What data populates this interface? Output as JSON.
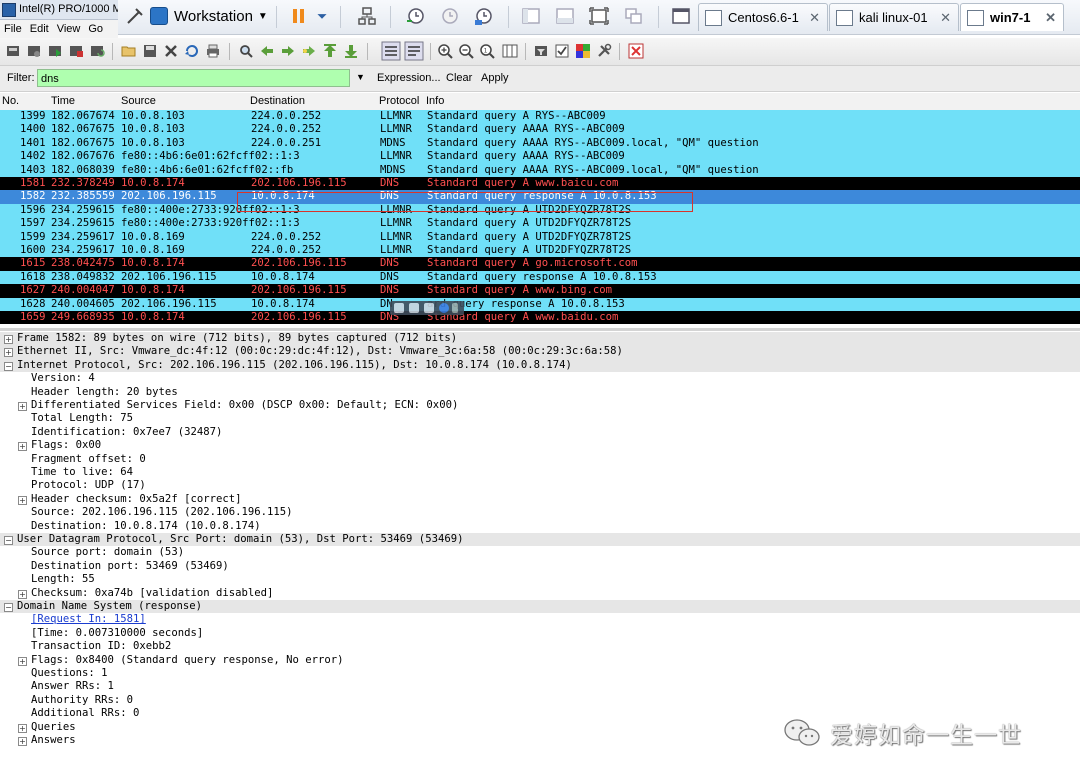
{
  "window": {
    "title": "Intel(R) PRO/1000 M",
    "menu": [
      "File",
      "Edit",
      "View",
      "Go"
    ]
  },
  "vmware": {
    "workspace_label": "Workstation",
    "tabs": [
      {
        "label": "Centos6.6-1",
        "active": false
      },
      {
        "label": "kali linux-01",
        "active": false
      },
      {
        "label": "win7-1",
        "active": true
      }
    ]
  },
  "filter": {
    "label": "Filter:",
    "value": "dns",
    "expression_label": "Expression...",
    "clear_label": "Clear",
    "apply_label": "Apply"
  },
  "packet_list": {
    "columns": [
      "No.",
      "Time",
      "Source",
      "Destination",
      "Protocol",
      "Info"
    ],
    "rows": [
      {
        "no": "1399",
        "time": "182.067674",
        "src": "10.0.8.103",
        "dst": "224.0.0.252",
        "proto": "LLMNR",
        "info": "Standard query A RYS--ABC009",
        "style": "c-llmnr"
      },
      {
        "no": "1400",
        "time": "182.067675",
        "src": "10.0.8.103",
        "dst": "224.0.0.252",
        "proto": "LLMNR",
        "info": "Standard query AAAA RYS--ABC009",
        "style": "c-llmnr"
      },
      {
        "no": "1401",
        "time": "182.067675",
        "src": "10.0.8.103",
        "dst": "224.0.0.251",
        "proto": "MDNS",
        "info": "Standard query AAAA RYS--ABC009.local, \"QM\" question",
        "style": "c-mdns"
      },
      {
        "no": "1402",
        "time": "182.067676",
        "src": "fe80::4b6:6e01:62fcff02::1:3",
        "dst": "",
        "proto": "LLMNR",
        "info": "Standard query AAAA RYS--ABC009",
        "style": "c-llmnr"
      },
      {
        "no": "1403",
        "time": "182.068039",
        "src": "fe80::4b6:6e01:62fcff02::fb",
        "dst": "",
        "proto": "MDNS",
        "info": "Standard query AAAA RYS--ABC009.local, \"QM\" question",
        "style": "c-mdns"
      },
      {
        "no": "1581",
        "time": "232.378249",
        "src": "10.0.8.174",
        "dst": "202.106.196.115",
        "proto": "DNS",
        "info": "Standard query A www.baicu.com",
        "style": "c-bad"
      },
      {
        "no": "1582",
        "time": "232.385559",
        "src": "202.106.196.115",
        "dst": "10.0.8.174",
        "proto": "DNS",
        "info": "Standard query response A 10.0.8.153",
        "style": "c-sel"
      },
      {
        "no": "1596",
        "time": "234.259615",
        "src": "fe80::400e:2733:920ff02::1:3",
        "dst": "",
        "proto": "LLMNR",
        "info": "Standard query A UTD2DFYQZR78T2S",
        "style": "c-llmnr"
      },
      {
        "no": "1597",
        "time": "234.259615",
        "src": "fe80::400e:2733:920ff02::1:3",
        "dst": "",
        "proto": "LLMNR",
        "info": "Standard query A UTD2DFYQZR78T2S",
        "style": "c-llmnr"
      },
      {
        "no": "1599",
        "time": "234.259617",
        "src": "10.0.8.169",
        "dst": "224.0.0.252",
        "proto": "LLMNR",
        "info": "Standard query A UTD2DFYQZR78T2S",
        "style": "c-llmnr"
      },
      {
        "no": "1600",
        "time": "234.259617",
        "src": "10.0.8.169",
        "dst": "224.0.0.252",
        "proto": "LLMNR",
        "info": "Standard query A UTD2DFYQZR78T2S",
        "style": "c-llmnr"
      },
      {
        "no": "1615",
        "time": "238.042475",
        "src": "10.0.8.174",
        "dst": "202.106.196.115",
        "proto": "DNS",
        "info": "Standard query A go.microsoft.com",
        "style": "c-bad"
      },
      {
        "no": "1618",
        "time": "238.049832",
        "src": "202.106.196.115",
        "dst": "10.0.8.174",
        "proto": "DNS",
        "info": "Standard query response A 10.0.8.153",
        "style": "c-resp"
      },
      {
        "no": "1627",
        "time": "240.004047",
        "src": "10.0.8.174",
        "dst": "202.106.196.115",
        "proto": "DNS",
        "info": "Standard query A www.bing.com",
        "style": "c-bad"
      },
      {
        "no": "1628",
        "time": "240.004605",
        "src": "202.106.196.115",
        "dst": "10.0.8.174",
        "proto": "DN",
        "info": "ard query response A 10.0.8.153",
        "style": "c-resp"
      },
      {
        "no": "1659",
        "time": "249.668935",
        "src": "10.0.8.174",
        "dst": "202.106.196.115",
        "proto": "DNS",
        "info": "Standard query A www.baidu.com",
        "style": "c-bad"
      }
    ]
  },
  "details": [
    {
      "level": 0,
      "toggle": "+",
      "text": "Frame 1582: 89 bytes on wire (712 bits), 89 bytes captured (712 bits)",
      "top": true
    },
    {
      "level": 0,
      "toggle": "+",
      "text": "Ethernet II, Src: Vmware_dc:4f:12 (00:0c:29:dc:4f:12), Dst: Vmware_3c:6a:58 (00:0c:29:3c:6a:58)",
      "top": true
    },
    {
      "level": 0,
      "toggle": "-",
      "text": "Internet Protocol, Src: 202.106.196.115 (202.106.196.115), Dst: 10.0.8.174 (10.0.8.174)",
      "top": true
    },
    {
      "level": 1,
      "toggle": "",
      "text": "Version: 4"
    },
    {
      "level": 1,
      "toggle": "",
      "text": "Header length: 20 bytes"
    },
    {
      "level": 1,
      "toggle": "+",
      "text": "Differentiated Services Field: 0x00 (DSCP 0x00: Default; ECN: 0x00)"
    },
    {
      "level": 1,
      "toggle": "",
      "text": "Total Length: 75"
    },
    {
      "level": 1,
      "toggle": "",
      "text": "Identification: 0x7ee7 (32487)"
    },
    {
      "level": 1,
      "toggle": "+",
      "text": "Flags: 0x00"
    },
    {
      "level": 1,
      "toggle": "",
      "text": "Fragment offset: 0"
    },
    {
      "level": 1,
      "toggle": "",
      "text": "Time to live: 64"
    },
    {
      "level": 1,
      "toggle": "",
      "text": "Protocol: UDP (17)"
    },
    {
      "level": 1,
      "toggle": "+",
      "text": "Header checksum: 0x5a2f [correct]"
    },
    {
      "level": 1,
      "toggle": "",
      "text": "Source: 202.106.196.115 (202.106.196.115)"
    },
    {
      "level": 1,
      "toggle": "",
      "text": "Destination: 10.0.8.174 (10.0.8.174)"
    },
    {
      "level": 0,
      "toggle": "-",
      "text": "User Datagram Protocol, Src Port: domain (53), Dst Port: 53469 (53469)",
      "top": true
    },
    {
      "level": 1,
      "toggle": "",
      "text": "Source port: domain (53)"
    },
    {
      "level": 1,
      "toggle": "",
      "text": "Destination port: 53469 (53469)"
    },
    {
      "level": 1,
      "toggle": "",
      "text": "Length: 55"
    },
    {
      "level": 1,
      "toggle": "+",
      "text": "Checksum: 0xa74b [validation disabled]"
    },
    {
      "level": 0,
      "toggle": "-",
      "text": "Domain Name System (response)",
      "top": true
    },
    {
      "level": 1,
      "toggle": "",
      "text": "[Request In: 1581]",
      "link": true
    },
    {
      "level": 1,
      "toggle": "",
      "text": "[Time: 0.007310000 seconds]"
    },
    {
      "level": 1,
      "toggle": "",
      "text": "Transaction ID: 0xebb2"
    },
    {
      "level": 1,
      "toggle": "+",
      "text": "Flags: 0x8400 (Standard query response, No error)"
    },
    {
      "level": 1,
      "toggle": "",
      "text": "Questions: 1"
    },
    {
      "level": 1,
      "toggle": "",
      "text": "Answer RRs: 1"
    },
    {
      "level": 1,
      "toggle": "",
      "text": "Authority RRs: 0"
    },
    {
      "level": 1,
      "toggle": "",
      "text": "Additional RRs: 0"
    },
    {
      "level": 1,
      "toggle": "+",
      "text": "Queries"
    },
    {
      "level": 1,
      "toggle": "+",
      "text": "Answers"
    }
  ],
  "watermark": {
    "text": "爱婷如命一生一世"
  },
  "colors": {
    "dns_black": "#000000",
    "dns_red_text": "#ff5050",
    "llmnr_cyan": "#70e0f8",
    "selected_blue": "#3d89da",
    "filter_green": "#afffaf",
    "highlight_box": "#d9342b"
  }
}
